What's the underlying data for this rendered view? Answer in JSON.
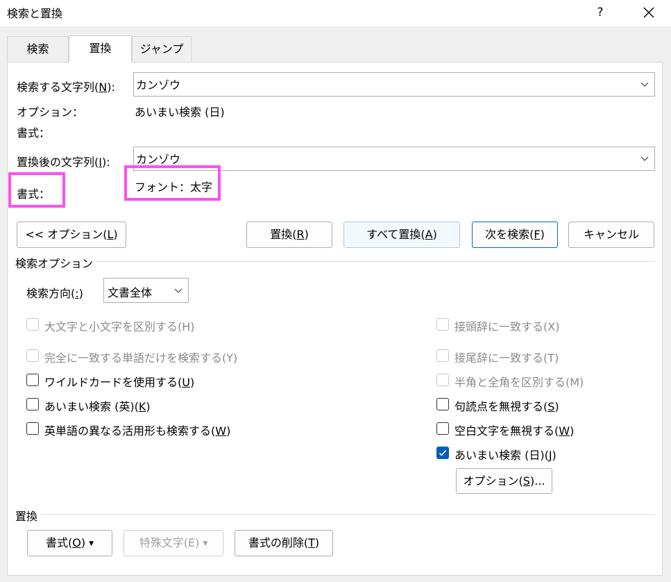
{
  "window": {
    "title": "検索と置換",
    "help": "?"
  },
  "tabs": [
    {
      "label": "検索"
    },
    {
      "label": "置換"
    },
    {
      "label": "ジャンプ"
    }
  ],
  "find": {
    "label_prefix": "検索する文字列(",
    "label_key": "N",
    "label_suffix": "):",
    "value": "カンゾウ",
    "options_label": "オプション：",
    "options_value": "あいまい検索 (日)",
    "format_label": "書式："
  },
  "replace": {
    "label_prefix": "置換後の文字列(",
    "label_key": "I",
    "label_suffix": "):",
    "value": "カンゾウ",
    "format_label": "書式：",
    "format_value": "フォント：太字"
  },
  "buttons": {
    "options_toggle_prefix": "<< オプション(",
    "options_toggle_key": "L",
    "options_toggle_suffix": ")",
    "replace_prefix": "置換(",
    "replace_key": "R",
    "replace_suffix": ")",
    "replace_all_prefix": "すべて置換(",
    "replace_all_key": "A",
    "replace_all_suffix": ")",
    "find_next_prefix": "次を検索(",
    "find_next_key": "F",
    "find_next_suffix": ")",
    "cancel": "キャンセル"
  },
  "search_options": {
    "title": "検索オプション",
    "direction_label_prefix": "検索方向(",
    "direction_label_key": ":",
    "direction_label_suffix": ")",
    "direction_value": "文書全体",
    "left": [
      {
        "label": "大文字と小文字を区別する(H)",
        "checked": false,
        "disabled": true
      },
      {
        "label": "完全に一致する単語だけを検索する(Y)",
        "checked": false,
        "disabled": true
      },
      {
        "label_prefix": "ワイルドカードを使用する(",
        "key": "U",
        "label_suffix": ")",
        "checked": false,
        "disabled": false
      },
      {
        "label_prefix": "あいまい検索 (英)(",
        "key": "K",
        "label_suffix": ")",
        "checked": false,
        "disabled": false
      },
      {
        "label_prefix": "英単語の異なる活用形も検索する(",
        "key": "W",
        "label_suffix": ")",
        "checked": false,
        "disabled": false
      }
    ],
    "right": [
      {
        "label": "接頭辞に一致する(X)",
        "checked": false,
        "disabled": true
      },
      {
        "label": "接尾辞に一致する(T)",
        "checked": false,
        "disabled": true
      },
      {
        "label": "半角と全角を区別する(M)",
        "checked": false,
        "disabled": true
      },
      {
        "label_prefix": "句読点を無視する(",
        "key": "S",
        "label_suffix": ")",
        "checked": false,
        "disabled": false
      },
      {
        "label_prefix": "空白文字を無視する(",
        "key": "W",
        "label_suffix": ")",
        "checked": false,
        "disabled": false
      },
      {
        "label_prefix": "あいまい検索 (日)(",
        "key": "J",
        "label_suffix": ")",
        "checked": true,
        "disabled": false
      }
    ],
    "options_button_prefix": "オプション(",
    "options_button_key": "S",
    "options_button_suffix": ")..."
  },
  "replace_section": {
    "title": "置換",
    "format_prefix": "書式(",
    "format_key": "O",
    "format_suffix": ")",
    "special_label": "特殊文字(E)",
    "clear_prefix": "書式の削除(",
    "clear_key": "T",
    "clear_suffix": ")"
  },
  "colors": {
    "highlight": "#ff4df5",
    "checkbox_checked": "#005fb8",
    "primary_border": "#0067c0"
  }
}
